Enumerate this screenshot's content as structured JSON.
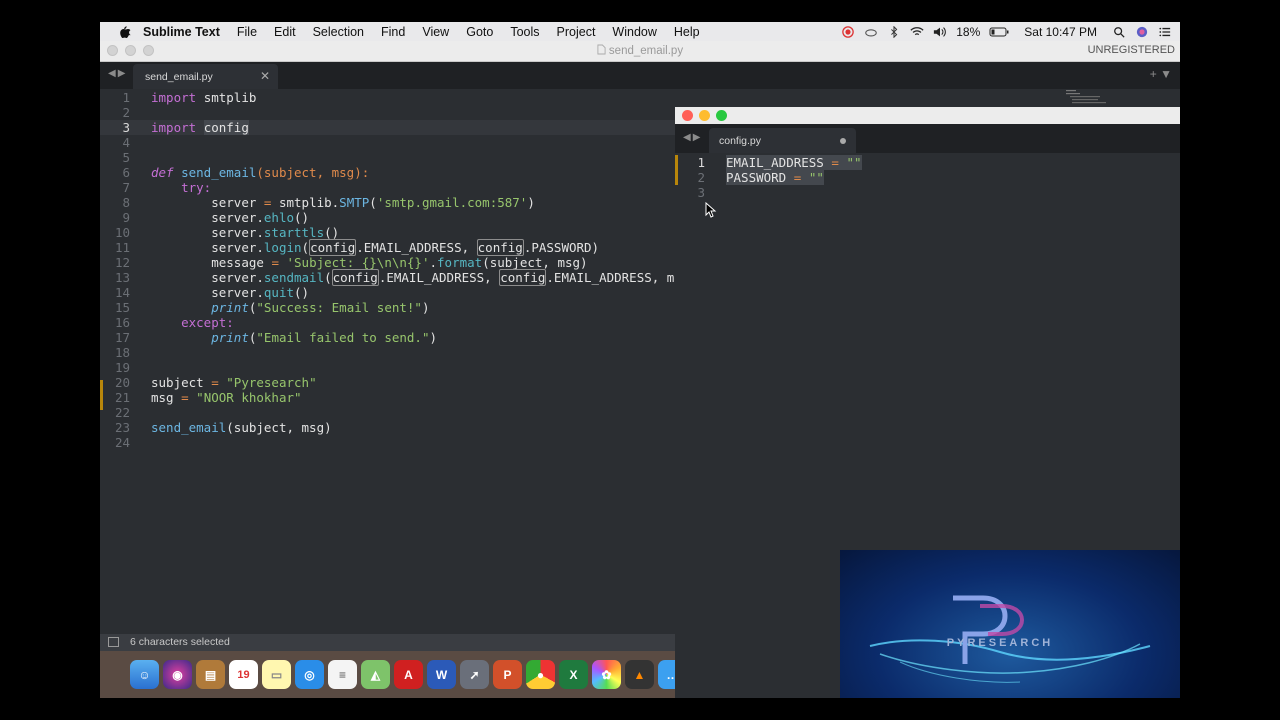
{
  "menubar": {
    "app_name": "Sublime Text",
    "items": [
      "File",
      "Edit",
      "Selection",
      "Find",
      "View",
      "Goto",
      "Tools",
      "Project",
      "Window",
      "Help"
    ],
    "battery": "18%",
    "clock": "Sat 10:47 PM"
  },
  "window": {
    "title": "send_email.py",
    "unregistered": "UNREGISTERED",
    "tab_label": "send_email.py",
    "status_text": "6 characters selected"
  },
  "editor": {
    "line_numbers": [
      "1",
      "2",
      "3",
      "4",
      "5",
      "6",
      "7",
      "8",
      "9",
      "10",
      "11",
      "12",
      "13",
      "14",
      "15",
      "16",
      "17",
      "18",
      "19",
      "20",
      "21",
      "22",
      "23",
      "24"
    ],
    "tokens": {
      "import": "import",
      "smtplib": "smtplib",
      "config": "config",
      "def": "def",
      "send_email": "send_email",
      "params": "(subject, msg):",
      "try": "try:",
      "server_assign": "server ",
      "eq": "=",
      "smtplib_dot": " smtplib.",
      "SMTP": "SMTP",
      "smtp_arg": "'smtp.gmail.com:587'",
      "server_dot": "server.",
      "ehlo": "ehlo",
      "starttls": "starttls",
      "login": "login",
      "email_address": ".EMAIL_ADDRESS, ",
      "password": ".PASSWORD)",
      "message": "message ",
      "subject_fmt": "'Subject: {}\\n\\n{}'",
      "format": "format",
      "fmt_args": "(subject, msg)",
      "sendmail": "sendmail",
      "email_address2": ".EMAIL_ADDRESS, m",
      "quit": "quit",
      "print": "print",
      "success": "\"Success: Email sent!\"",
      "except": "except:",
      "failed": "\"Email failed to send.\"",
      "subject_var": "subject ",
      "subject_val": "\"Pyresearch\"",
      "msg_var": "msg ",
      "msg_val": "\"NOOR khokhar\"",
      "call_args": "(subject, msg)"
    }
  },
  "config_window": {
    "tab_label": "config.py",
    "line_numbers": [
      "1",
      "2",
      "3"
    ],
    "line1_key": "EMAIL_ADDRESS",
    "line1_eq": "=",
    "line1_val": "\"\"",
    "line2_key": "PASSWORD",
    "line2_eq": "=",
    "line2_val": "\"\""
  },
  "logo": {
    "brand": "PYRESEARCH"
  },
  "dock": {
    "calendar_day": "19"
  },
  "colors": {
    "editor_bg": "#2b2e32",
    "keyword": "#c46fd4",
    "function": "#6cb6e2",
    "string": "#97c56c",
    "operator": "#e08a4b"
  }
}
